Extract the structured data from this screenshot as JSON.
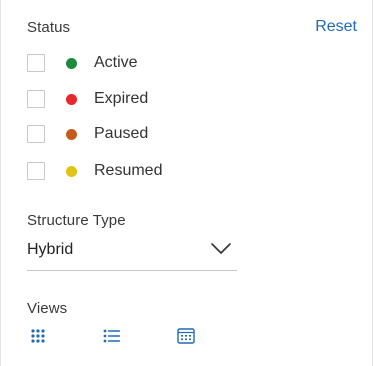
{
  "filters": {
    "status": {
      "label": "Status",
      "reset_label": "Reset",
      "items": [
        {
          "label": "Active",
          "color": "#1e8a3a",
          "checked": false
        },
        {
          "label": "Expired",
          "color": "#e8262b",
          "checked": false
        },
        {
          "label": "Paused",
          "color": "#c65a1e",
          "checked": false
        },
        {
          "label": "Resumed",
          "color": "#e0c414",
          "checked": false
        }
      ]
    },
    "structure_type": {
      "label": "Structure Type",
      "selected": "Hybrid",
      "icon": "chevron-down-icon"
    },
    "views": {
      "label": "Views",
      "items": [
        {
          "icon": "grid-dots-icon"
        },
        {
          "icon": "list-icon"
        },
        {
          "icon": "calendar-icon"
        }
      ]
    }
  },
  "colors": {
    "accent": "#1f6bb5",
    "icon": "#1f6bb5"
  }
}
